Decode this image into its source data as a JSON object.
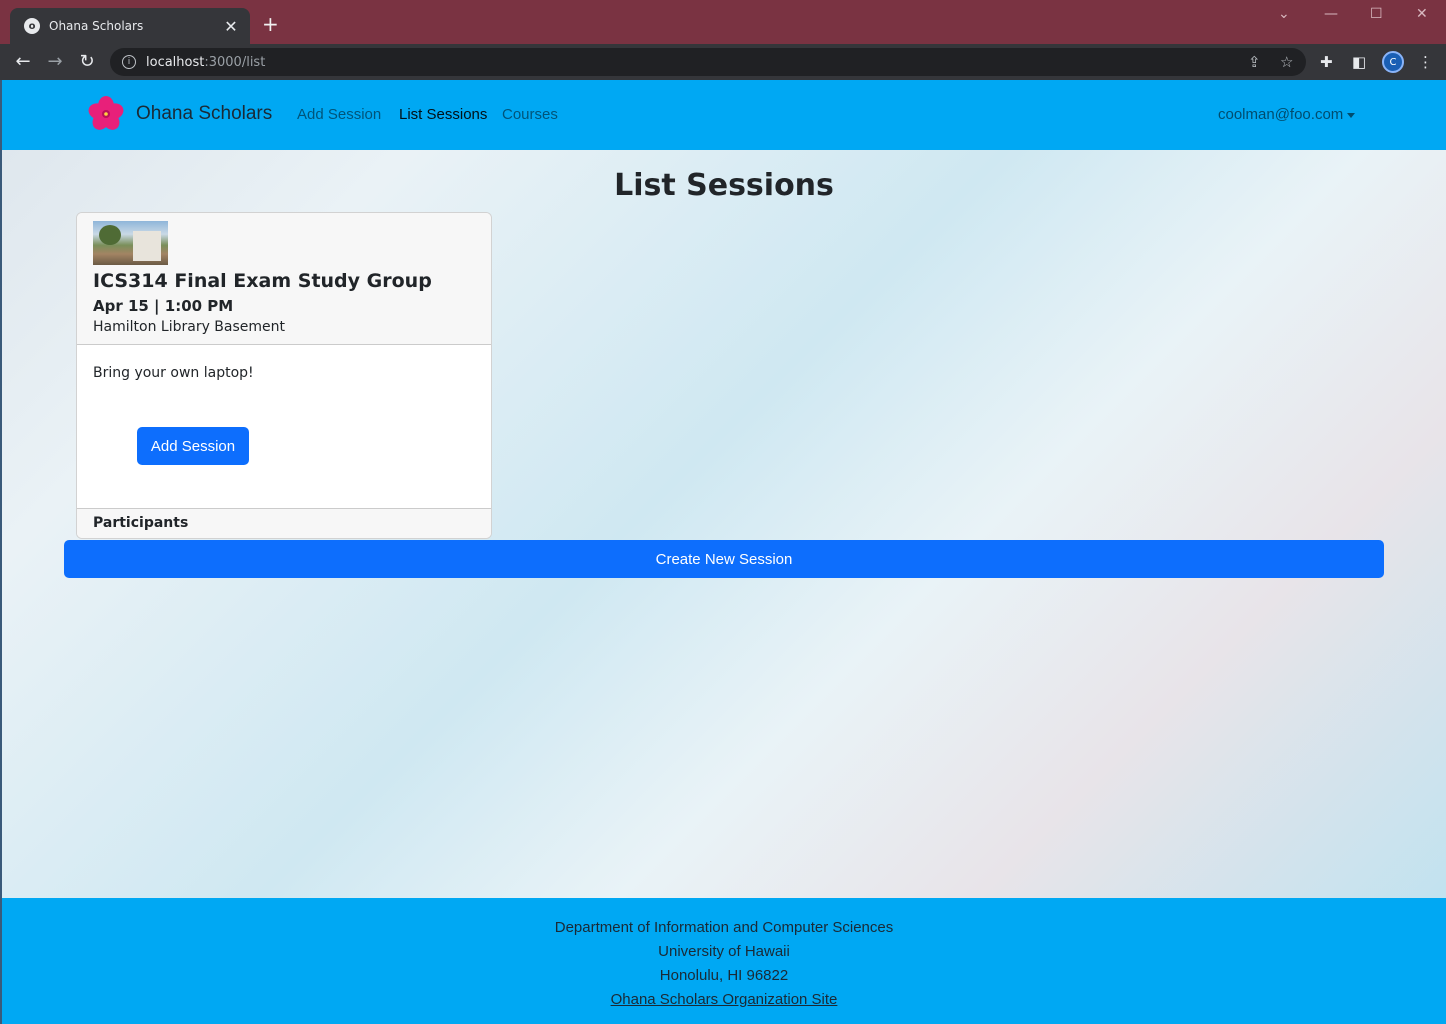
{
  "browser": {
    "tab_title": "Ohana Scholars",
    "tab_favicon": "ohana-favicon",
    "url_host": "localhost",
    "url_path": ":3000/list",
    "profile_initial": "C",
    "accent_titlebar": "#7a3342"
  },
  "navbar": {
    "brand": "Ohana Scholars",
    "links": [
      {
        "label": "Add Session",
        "active": false
      },
      {
        "label": "List Sessions",
        "active": true
      },
      {
        "label": "Courses",
        "active": false
      }
    ],
    "user": "coolman@foo.com",
    "color": "#00a8f3"
  },
  "main": {
    "heading": "List Sessions",
    "session": {
      "title": "ICS314 Final Exam Study Group",
      "date": "Apr 15 | 1:00 PM",
      "location": "Hamilton Library Basement",
      "description": "Bring your own laptop!",
      "action_label": "Add Session",
      "footer_label": "Participants"
    },
    "create_label": "Create New Session",
    "button_color": "#0d6efd"
  },
  "footer": {
    "line1": "Department of Information and Computer Sciences",
    "line2": "University of Hawaii",
    "line3": "Honolulu, HI 96822",
    "link": "Ohana Scholars Organization Site"
  }
}
